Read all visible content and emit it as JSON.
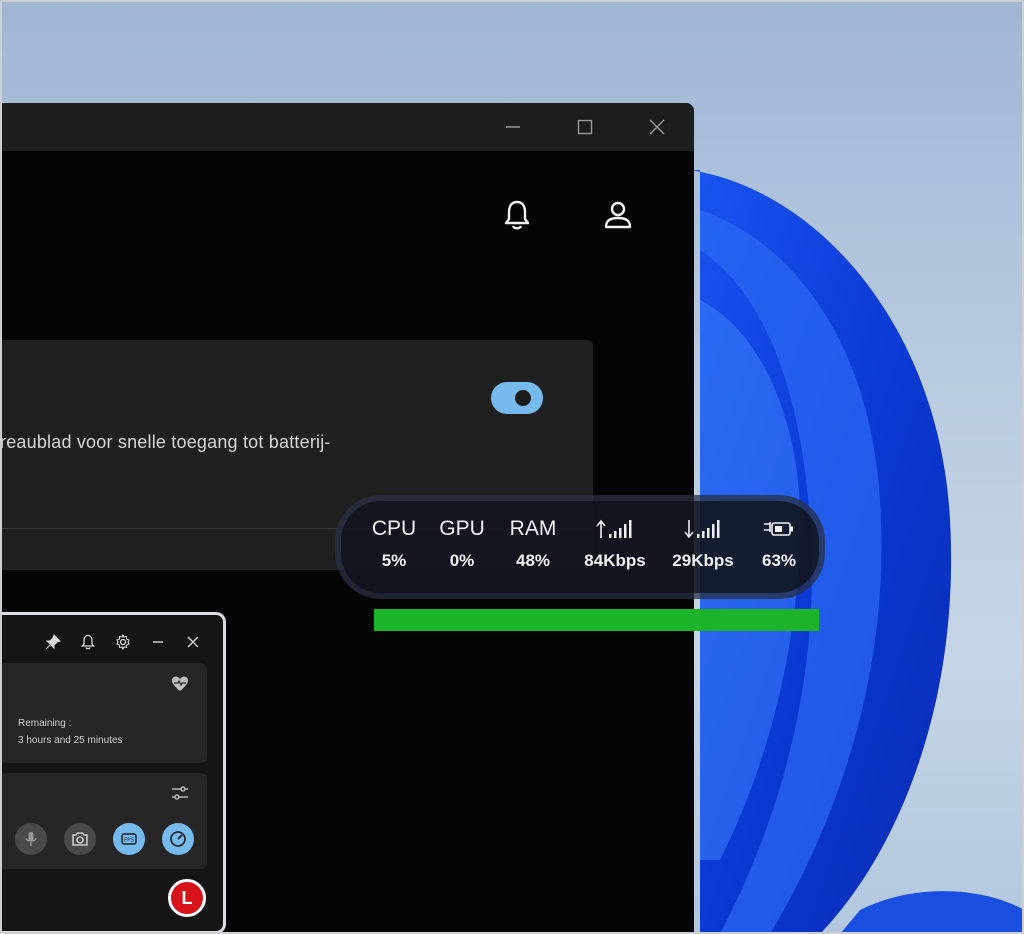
{
  "main_window": {
    "window_controls": [
      "minimize-icon",
      "maximize-icon",
      "close-icon"
    ],
    "header_icons": [
      "bell-icon",
      "user-icon"
    ],
    "card": {
      "text": "reaublad voor snelle toegang tot batterij-",
      "toggle_on": true
    }
  },
  "performance": {
    "cells": [
      {
        "label": "CPU",
        "value": "5%"
      },
      {
        "label": "GPU",
        "value": "0%"
      },
      {
        "label": "RAM",
        "value": "48%"
      },
      {
        "icon": "upload-signal-icon",
        "value": "84Kbps"
      },
      {
        "icon": "download-signal-icon",
        "value": "29Kbps"
      },
      {
        "icon": "battery-charging-icon",
        "value": "63%"
      }
    ]
  },
  "widget": {
    "top_icons": [
      "pin-icon",
      "bell-icon",
      "gear-icon",
      "minimize-icon",
      "close-icon"
    ],
    "battery": {
      "remaining_label": "Remaining :",
      "remaining_value": "3 hours and 25 minutes"
    },
    "avatar_letter": "L"
  },
  "colors": {
    "accent_toggle": "#76b9ed",
    "green_bar": "#1db32a",
    "avatar": "#d7131a"
  }
}
